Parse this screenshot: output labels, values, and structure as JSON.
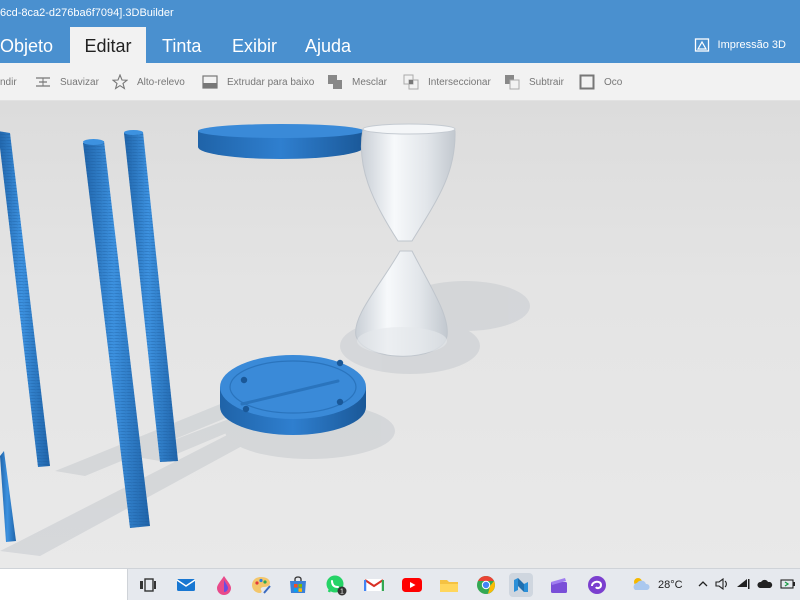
{
  "window": {
    "title": "6cd-8ca2-d276ba6f7094].3DBuilder"
  },
  "menu": {
    "tabs": [
      {
        "label": "Objeto"
      },
      {
        "label": "Editar",
        "active": true
      },
      {
        "label": "Tinta"
      },
      {
        "label": "Exibir"
      },
      {
        "label": "Ajuda"
      }
    ],
    "print_label": "Impressão 3D"
  },
  "toolbar": {
    "items": [
      {
        "label": "ndir",
        "icon": "expand-icon"
      },
      {
        "label": "Suavizar",
        "icon": "smooth-icon"
      },
      {
        "label": "Alto-relevo",
        "icon": "star-icon"
      },
      {
        "label": "Extrudar para baixo",
        "icon": "extrude-down-icon"
      },
      {
        "label": "Mesclar",
        "icon": "merge-icon"
      },
      {
        "label": "Interseccionar",
        "icon": "intersect-icon"
      },
      {
        "label": "Subtrair",
        "icon": "subtract-icon"
      },
      {
        "label": "Oco",
        "icon": "hollow-icon"
      }
    ]
  },
  "colors": {
    "accent": "#4a90cf",
    "model_blue": "#2f7fcf",
    "model_blue_dark": "#1f63a8",
    "glass": "#eef1f4"
  },
  "taskbar": {
    "apps": [
      {
        "icon": "task-view-icon"
      },
      {
        "icon": "mail-icon"
      },
      {
        "icon": "paint-drop-icon"
      },
      {
        "icon": "paint-palette-icon"
      },
      {
        "icon": "store-icon"
      },
      {
        "icon": "whatsapp-icon",
        "badge": "1"
      },
      {
        "icon": "gmail-icon"
      },
      {
        "icon": "youtube-icon"
      },
      {
        "icon": "file-explorer-icon"
      },
      {
        "icon": "chrome-icon"
      },
      {
        "icon": "3d-builder-icon",
        "active": true
      },
      {
        "icon": "clapperboard-icon"
      },
      {
        "icon": "swirl-app-icon"
      }
    ],
    "weather": {
      "temperature": "28°C",
      "icon": "cloud-sun-icon"
    },
    "tray_icons": [
      "chevron-up-icon",
      "speaker-icon",
      "wifi-icon",
      "onedrive-icon",
      "battery-icon",
      "network-icon"
    ]
  }
}
